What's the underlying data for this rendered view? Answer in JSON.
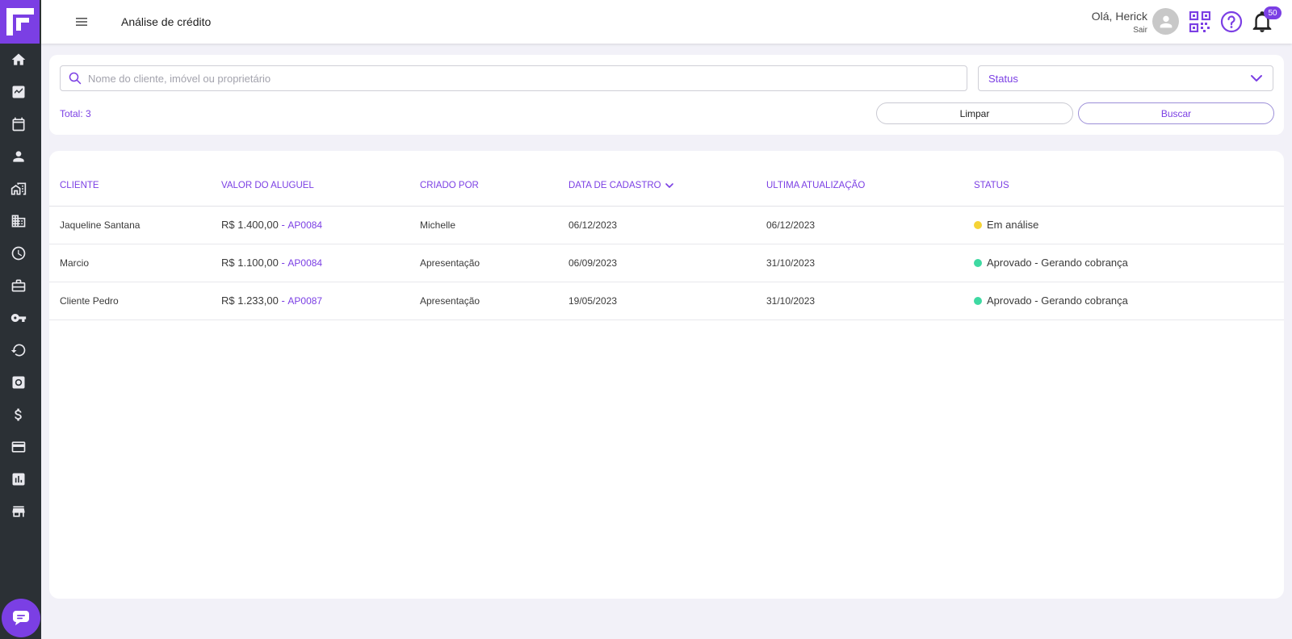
{
  "app": {
    "page_title": "Análise de crédito",
    "greeting": "Olá, Herick",
    "logout_label": "Sair",
    "notification_count": "50"
  },
  "sidebar": {
    "items": [
      {
        "icon": "home-icon"
      },
      {
        "icon": "chart-trend-icon"
      },
      {
        "icon": "calendar-icon"
      },
      {
        "icon": "person-icon"
      },
      {
        "icon": "house-buildings-icon"
      },
      {
        "icon": "building-icon"
      },
      {
        "icon": "clock-icon"
      },
      {
        "icon": "briefcase-icon"
      },
      {
        "icon": "key-icon"
      },
      {
        "icon": "refresh-icon"
      },
      {
        "icon": "safe-icon"
      },
      {
        "icon": "dollar-icon"
      },
      {
        "icon": "credit-card-icon"
      },
      {
        "icon": "bar-chart-icon"
      },
      {
        "icon": "store-icon"
      }
    ]
  },
  "filters": {
    "search_placeholder": "Nome do cliente, imóvel ou proprietário",
    "search_value": "",
    "status_label": "Status",
    "total_label": "Total: 3",
    "clear_label": "Limpar",
    "search_label": "Buscar"
  },
  "table": {
    "columns": {
      "cliente": "CLIENTE",
      "valor": "VALOR DO ALUGUEL",
      "criado_por": "CRIADO POR",
      "data_cadastro": "DATA DE CADASTRO",
      "ultima_atualizacao": "ULTIMA ATUALIZAÇÃO",
      "status": "STATUS"
    },
    "rows": [
      {
        "cliente": "Jaqueline Santana",
        "valor": "R$ 1.400,00",
        "separator": " - ",
        "codigo": "AP0084",
        "criado_por": "Michelle",
        "data_cadastro": "06/12/2023",
        "ultima_atualizacao": "06/12/2023",
        "status": "Em análise",
        "status_color": "#f5d336"
      },
      {
        "cliente": "Marcio",
        "valor": "R$ 1.100,00",
        "separator": " - ",
        "codigo": "AP0084",
        "criado_por": "Apresentação",
        "data_cadastro": "06/09/2023",
        "ultima_atualizacao": "31/10/2023",
        "status": "Aprovado - Gerando cobrança",
        "status_color": "#3ed9a2"
      },
      {
        "cliente": "Cliente Pedro",
        "valor": "R$ 1.233,00",
        "separator": " - ",
        "codigo": "AP0087",
        "criado_por": "Apresentação",
        "data_cadastro": "19/05/2023",
        "ultima_atualizacao": "31/10/2023",
        "status": "Aprovado - Gerando cobrança",
        "status_color": "#3ed9a2"
      }
    ]
  },
  "colors": {
    "accent": "#7b3fe4",
    "sidebar_bg": "#2b3035",
    "page_bg": "#f2f1f8"
  }
}
